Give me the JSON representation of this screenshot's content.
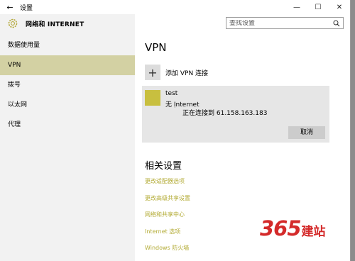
{
  "window": {
    "title": "设置",
    "back_glyph": "←",
    "min_glyph": "—",
    "max_glyph": "☐",
    "close_glyph": "✕"
  },
  "header": {
    "title": "网络和 INTERNET"
  },
  "search": {
    "placeholder": "查找设置"
  },
  "sidebar": {
    "items": [
      {
        "label": "数据使用量"
      },
      {
        "label": "VPN"
      },
      {
        "label": "拨号"
      },
      {
        "label": "以太网"
      },
      {
        "label": "代理"
      }
    ]
  },
  "main": {
    "heading": "VPN",
    "add_label": "添加 VPN 连接",
    "connection": {
      "name": "test",
      "network": "无 Internet",
      "status": "正在连接到 61.158.163.183",
      "cancel_label": "取消"
    },
    "related_heading": "相关设置",
    "related_links": [
      {
        "label": "更改适配器选项"
      },
      {
        "label": "更改高级共享设置"
      },
      {
        "label": "网络和共享中心"
      },
      {
        "label": "Internet 选项"
      },
      {
        "label": "Windows 防火墙"
      }
    ]
  },
  "watermark": {
    "number": "365",
    "text": "建站"
  },
  "colors": {
    "accent": "#c8bf3f",
    "active_nav": "#d3d1a3",
    "link": "#b3ab35",
    "watermark": "#d42a2a"
  },
  "icons": {
    "header": "gear-icon",
    "search": "search-icon",
    "add": "plus-icon",
    "connection": "vpn-tile-icon"
  }
}
